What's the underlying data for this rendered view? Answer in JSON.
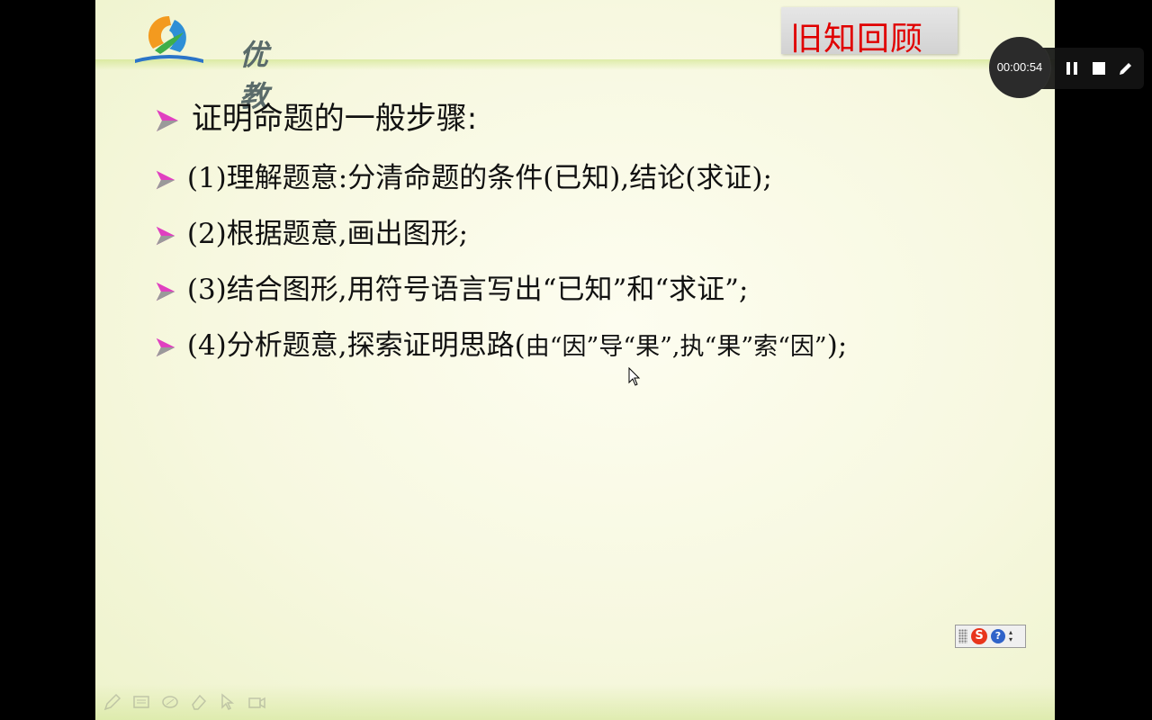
{
  "slide": {
    "logo_text": "优教",
    "review_title": "旧知回顾",
    "heading": "证明命题的一般步骤:",
    "items": [
      {
        "label": "(1)理解题意:分清命题的条件(已知),结论(求证);"
      },
      {
        "label": "(2)根据题意,画出图形;"
      },
      {
        "label": "(3)结合图形,用符号语言写出“已知”和“求证”;"
      },
      {
        "label_main": "(4)分析题意,探索证明思路(",
        "label_small": "由“因”导“果”,执“果”索“因”",
        "label_end": ");"
      }
    ]
  },
  "recorder": {
    "timer": "00:00:54",
    "pause_icon": "pause-icon",
    "stop_icon": "stop-icon",
    "pen_icon": "pencil-icon"
  },
  "ime": {
    "logo": "S",
    "help": "?",
    "colors": {
      "logo": "#e8351c",
      "help": "#2f63c9"
    }
  },
  "pen_toolbar": {
    "icons": [
      "pencil-icon",
      "slides-icon",
      "eraser-circle-icon",
      "eraser-icon",
      "pointer-icon",
      "camera-icon"
    ]
  },
  "colors": {
    "arrow_left": "#e040c0",
    "arrow_right": "#9a9a9a",
    "review_text": "#e00000"
  }
}
